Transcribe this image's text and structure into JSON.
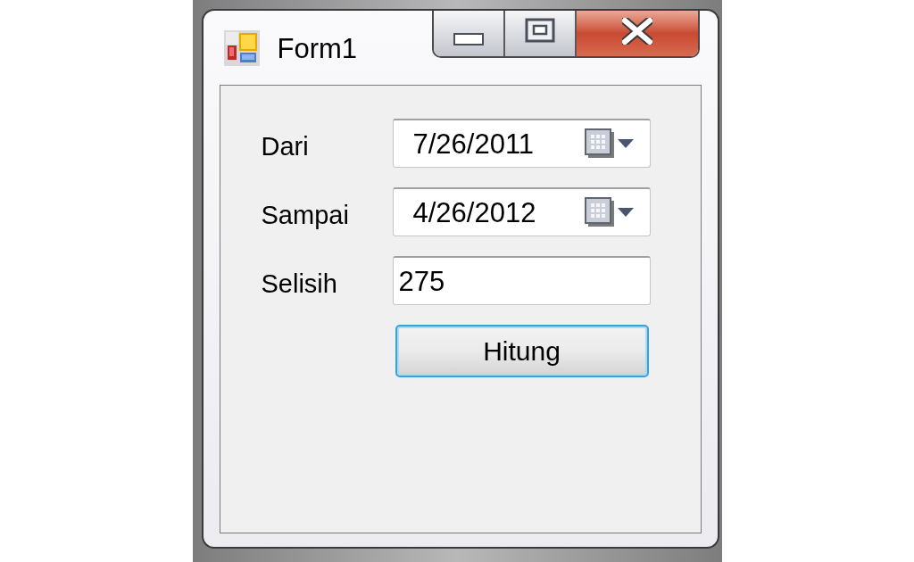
{
  "window": {
    "title": "Form1"
  },
  "form": {
    "rows": [
      {
        "label": "Dari",
        "kind": "date",
        "value": "7/26/2011"
      },
      {
        "label": "Sampai",
        "kind": "date",
        "value": "4/26/2012"
      },
      {
        "label": "Selisih",
        "kind": "text",
        "value": "275"
      }
    ],
    "button": {
      "label": "Hitung",
      "focused": true
    }
  }
}
